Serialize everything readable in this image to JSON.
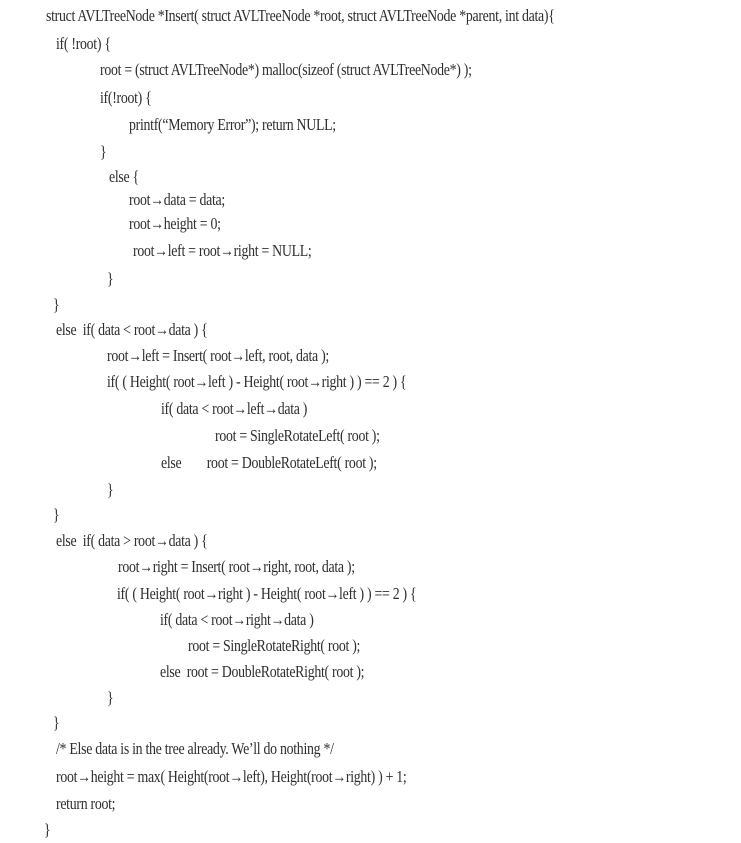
{
  "code": {
    "lines": [
      "struct AVLTreeNode *Insert( struct AVLTreeNode *root, struct AVLTreeNode *parent, int data){",
      "if( !root) {",
      "root = (struct AVLTreeNode*) malloc(sizeof (struct AVLTreeNode*) );",
      "if(!root) {",
      "printf(“Memory Error”); return NULL;",
      "}",
      "else {",
      "root→data = data;",
      "root→height = 0;",
      "root→left = root→right = NULL;",
      "}",
      "}",
      "else  if( data < root→data ) {",
      "root→left = Insert( root→left, root, data );",
      "if( ( Height( root→left ) - Height( root→right ) ) == 2 ) {",
      "if( data < root→left→data )",
      "root = SingleRotateLeft( root );",
      "else        root = DoubleRotateLeft( root );",
      "}",
      "}",
      "else  if( data > root→data ) {",
      "root→right = Insert( root→right, root, data );",
      "if( ( Height( root→right ) - Height( root→left ) ) == 2 ) {",
      "if( data < root→right→data )",
      "root = SingleRotateRight( root );",
      "else  root = DoubleRotateRight( root );",
      "}",
      "}",
      "/* Else data is in the tree already. We’ll do nothing */",
      "root→height = max( Height(root→left), Height(root→right) ) + 1;",
      "return root;",
      "}"
    ]
  }
}
